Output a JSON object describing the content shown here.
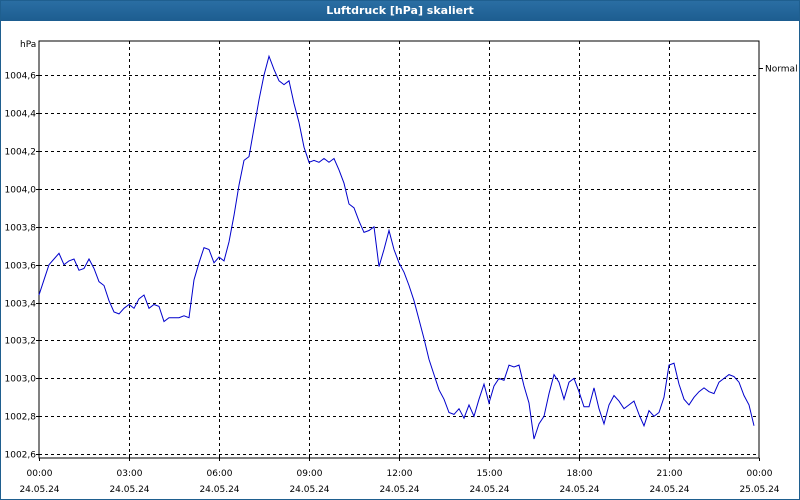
{
  "window": {
    "title": "Luftdruck [hPa] skaliert"
  },
  "chart_data": {
    "type": "line",
    "title": "Luftdruck [hPa] skaliert",
    "ylabel": "hPa",
    "xlabel": "",
    "ylim": [
      1002.58,
      1004.78
    ],
    "y_ticks": [
      "1002,6",
      "1002,8",
      "1003,0",
      "1003,2",
      "1003,4",
      "1003,6",
      "1003,8",
      "1004,0",
      "1004,2",
      "1004,4",
      "1004,6"
    ],
    "x_ticks": [
      {
        "time": "00:00",
        "date": "24.05.24"
      },
      {
        "time": "03:00",
        "date": "24.05.24"
      },
      {
        "time": "06:00",
        "date": "24.05.24"
      },
      {
        "time": "09:00",
        "date": "24.05.24"
      },
      {
        "time": "12:00",
        "date": "24.05.24"
      },
      {
        "time": "15:00",
        "date": "24.05.24"
      },
      {
        "time": "18:00",
        "date": "24.05.24"
      },
      {
        "time": "21:00",
        "date": "24.05.24"
      },
      {
        "time": "00:00",
        "date": "25.05.24"
      }
    ],
    "reference_line": {
      "label": "Normal",
      "value": 1004.64
    },
    "grid": true,
    "line_color": "#0000cc",
    "series": [
      {
        "x": [
          "24.05.24 00:00",
          "24.05.24 00:10",
          "24.05.24 00:20",
          "24.05.24 00:30",
          "24.05.24 00:40",
          "24.05.24 00:50",
          "24.05.24 01:00",
          "24.05.24 01:10",
          "24.05.24 01:20",
          "24.05.24 01:30",
          "24.05.24 01:40",
          "24.05.24 01:50",
          "24.05.24 02:00",
          "24.05.24 02:10",
          "24.05.24 02:20",
          "24.05.24 02:30",
          "24.05.24 02:40",
          "24.05.24 02:50",
          "24.05.24 03:00",
          "24.05.24 03:10",
          "24.05.24 03:20",
          "24.05.24 03:30",
          "24.05.24 03:40",
          "24.05.24 03:50",
          "24.05.24 04:00",
          "24.05.24 04:10",
          "24.05.24 04:20",
          "24.05.24 04:30",
          "24.05.24 04:40",
          "24.05.24 04:50",
          "24.05.24 05:00",
          "24.05.24 05:10",
          "24.05.24 05:20",
          "24.05.24 05:30",
          "24.05.24 05:40",
          "24.05.24 05:50",
          "24.05.24 06:00",
          "24.05.24 06:10",
          "24.05.24 06:20",
          "24.05.24 06:30",
          "24.05.24 06:40",
          "24.05.24 06:50",
          "24.05.24 07:00",
          "24.05.24 07:10",
          "24.05.24 07:20",
          "24.05.24 07:30",
          "24.05.24 07:40",
          "24.05.24 07:50",
          "24.05.24 08:00",
          "24.05.24 08:10",
          "24.05.24 08:20",
          "24.05.24 08:30",
          "24.05.24 08:40",
          "24.05.24 08:50",
          "24.05.24 09:00",
          "24.05.24 09:10",
          "24.05.24 09:20",
          "24.05.24 09:30",
          "24.05.24 09:40",
          "24.05.24 09:50",
          "24.05.24 10:00",
          "24.05.24 10:10",
          "24.05.24 10:20",
          "24.05.24 10:30",
          "24.05.24 10:40",
          "24.05.24 10:50",
          "24.05.24 11:00",
          "24.05.24 11:10",
          "24.05.24 11:20",
          "24.05.24 11:30",
          "24.05.24 11:40",
          "24.05.24 11:50",
          "24.05.24 12:00",
          "24.05.24 12:10",
          "24.05.24 12:20",
          "24.05.24 12:30",
          "24.05.24 12:40",
          "24.05.24 12:50",
          "24.05.24 13:00",
          "24.05.24 13:10",
          "24.05.24 13:20",
          "24.05.24 13:30",
          "24.05.24 13:40",
          "24.05.24 13:50",
          "24.05.24 14:00",
          "24.05.24 14:10",
          "24.05.24 14:20",
          "24.05.24 14:30",
          "24.05.24 14:40",
          "24.05.24 14:50",
          "24.05.24 15:00",
          "24.05.24 15:10",
          "24.05.24 15:20",
          "24.05.24 15:30",
          "24.05.24 15:40",
          "24.05.24 15:50",
          "24.05.24 16:00",
          "24.05.24 16:10",
          "24.05.24 16:20",
          "24.05.24 16:30",
          "24.05.24 16:40",
          "24.05.24 16:50",
          "24.05.24 17:00",
          "24.05.24 17:10",
          "24.05.24 17:20",
          "24.05.24 17:30",
          "24.05.24 17:40",
          "24.05.24 17:50",
          "24.05.24 18:00",
          "24.05.24 18:10",
          "24.05.24 18:20",
          "24.05.24 18:30",
          "24.05.24 18:40",
          "24.05.24 18:50",
          "24.05.24 19:00",
          "24.05.24 19:10",
          "24.05.24 19:20",
          "24.05.24 19:30",
          "24.05.24 19:40",
          "24.05.24 19:50",
          "24.05.24 20:00",
          "24.05.24 20:10",
          "24.05.24 20:20",
          "24.05.24 20:30",
          "24.05.24 20:40",
          "24.05.24 20:50",
          "24.05.24 21:00",
          "24.05.24 21:10",
          "24.05.24 21:20",
          "24.05.24 21:30",
          "24.05.24 21:40",
          "24.05.24 21:50",
          "24.05.24 22:00",
          "24.05.24 22:10",
          "24.05.24 22:20",
          "24.05.24 22:30",
          "24.05.24 22:40",
          "24.05.24 22:50",
          "24.05.24 23:00",
          "24.05.24 23:10",
          "24.05.24 23:20",
          "24.05.24 23:30",
          "24.05.24 23:40",
          "24.05.24 23:50"
        ],
        "y": [
          1003.44,
          1003.52,
          1003.6,
          1003.63,
          1003.66,
          1003.6,
          1003.62,
          1003.63,
          1003.57,
          1003.58,
          1003.63,
          1003.58,
          1003.51,
          1003.49,
          1003.41,
          1003.35,
          1003.34,
          1003.37,
          1003.39,
          1003.37,
          1003.42,
          1003.44,
          1003.37,
          1003.39,
          1003.38,
          1003.3,
          1003.32,
          1003.32,
          1003.32,
          1003.33,
          1003.32,
          1003.52,
          1003.61,
          1003.69,
          1003.68,
          1003.61,
          1003.64,
          1003.62,
          1003.72,
          1003.86,
          1004.02,
          1004.15,
          1004.17,
          1004.32,
          1004.47,
          1004.6,
          1004.7,
          1004.63,
          1004.57,
          1004.55,
          1004.57,
          1004.45,
          1004.35,
          1004.22,
          1004.14,
          1004.15,
          1004.14,
          1004.16,
          1004.14,
          1004.16,
          1004.1,
          1004.03,
          1003.92,
          1003.9,
          1003.83,
          1003.77,
          1003.78,
          1003.8,
          1003.59,
          1003.68,
          1003.78,
          1003.68,
          1003.61,
          1003.56,
          1003.49,
          1003.41,
          1003.31,
          1003.21,
          1003.1,
          1003.02,
          1002.94,
          1002.89,
          1002.82,
          1002.81,
          1002.84,
          1002.79,
          1002.86,
          1002.8,
          1002.89,
          1002.97,
          1002.87,
          1002.96,
          1003.0,
          1002.99,
          1003.07,
          1003.06,
          1003.07,
          1002.96,
          1002.87,
          1002.68,
          1002.76,
          1002.8,
          1002.92,
          1003.02,
          1002.98,
          1002.89,
          1002.98,
          1003.0,
          1002.93,
          1002.85,
          1002.85,
          1002.95,
          1002.84,
          1002.76,
          1002.86,
          1002.91,
          1002.88,
          1002.84,
          1002.86,
          1002.88,
          1002.81,
          1002.75,
          1002.83,
          1002.8,
          1002.82,
          1002.9,
          1003.07,
          1003.08,
          1002.97,
          1002.89,
          1002.86,
          1002.9,
          1002.93,
          1002.95,
          1002.93,
          1002.92,
          1002.98,
          1003.0,
          1003.02,
          1003.01,
          1002.98,
          1002.91,
          1002.86,
          1002.75
        ]
      }
    ]
  }
}
